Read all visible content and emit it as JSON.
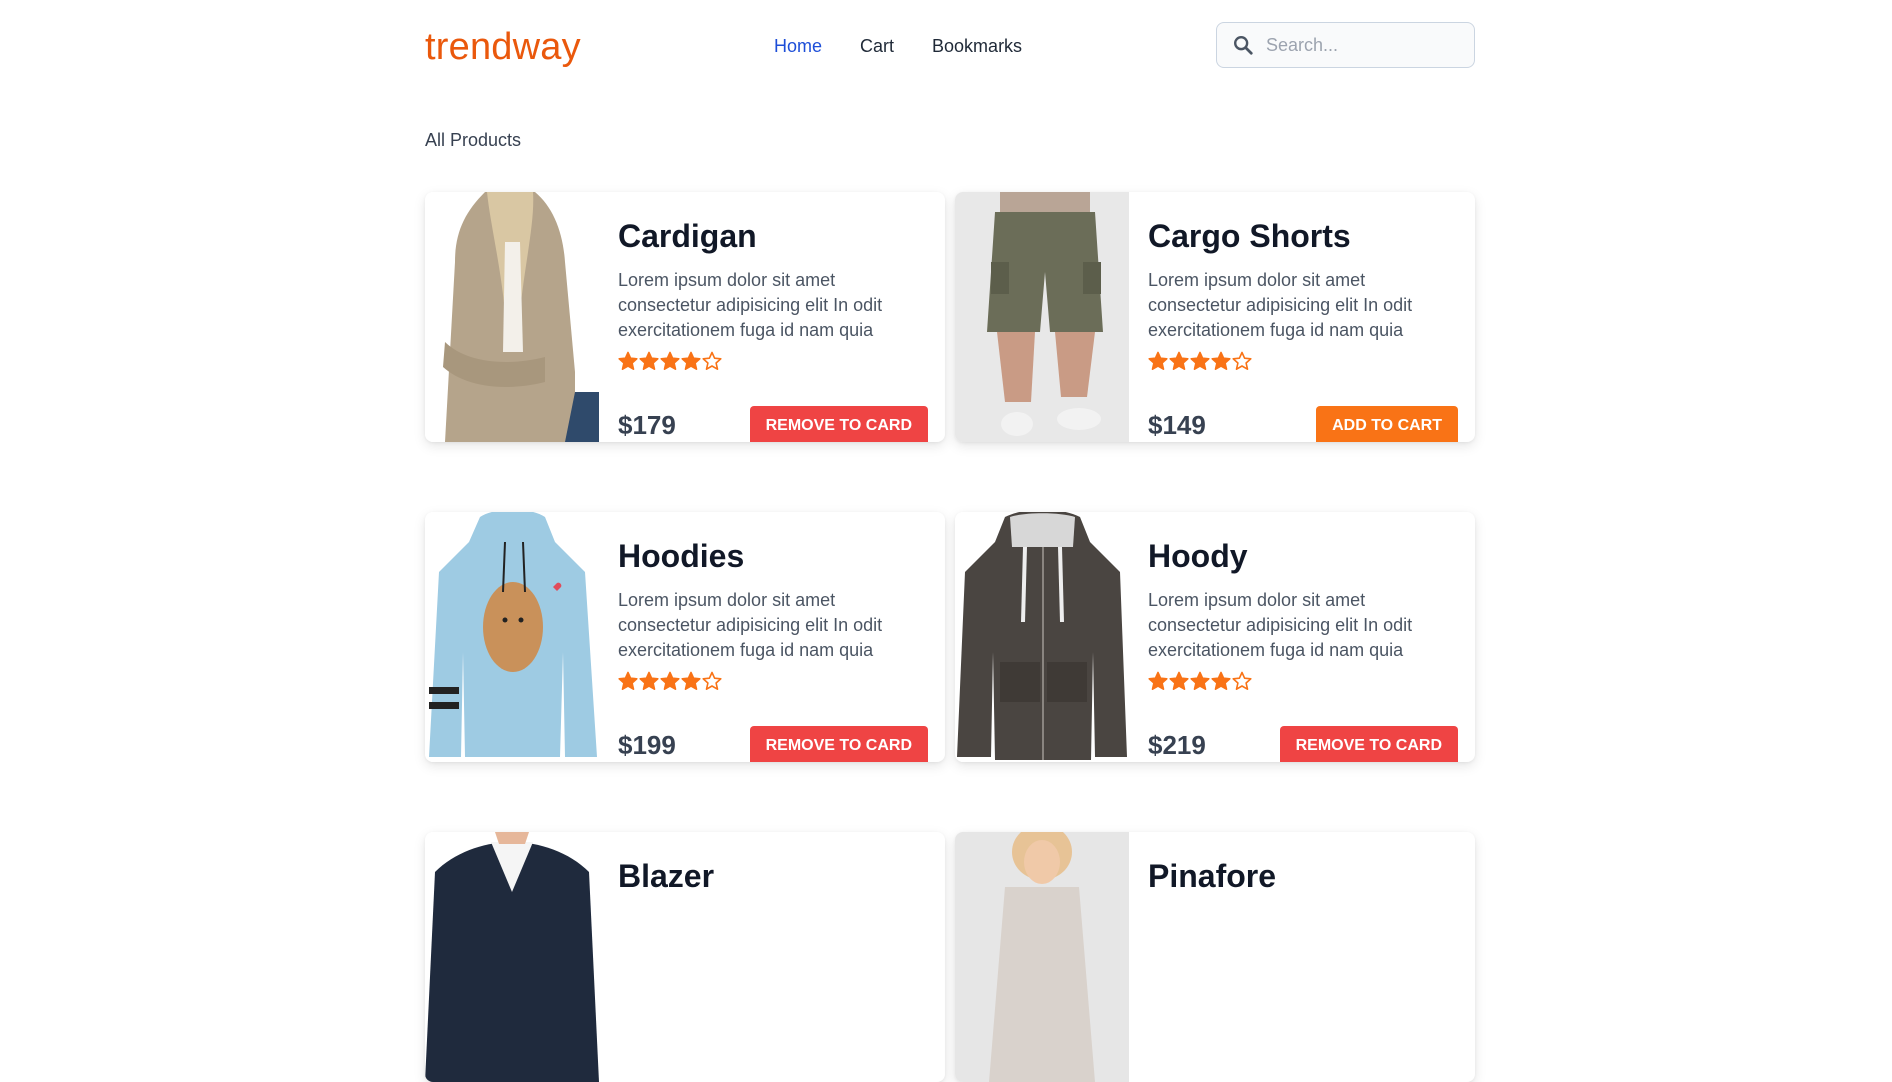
{
  "brand": "trendway",
  "nav": {
    "home": "Home",
    "cart": "Cart",
    "bookmarks": "Bookmarks"
  },
  "search": {
    "placeholder": "Search...",
    "value": ""
  },
  "section_title": "All Products",
  "products": [
    {
      "name": "Cardigan",
      "description": "Lorem ipsum dolor sit amet consectetur adipisicing elit In odit exercitationem fuga id nam quia",
      "rating": 4,
      "rating_max": 5,
      "price": "$179",
      "button": "REMOVE TO CARD",
      "button_type": "remove"
    },
    {
      "name": "Cargo Shorts",
      "description": "Lorem ipsum dolor sit amet consectetur adipisicing elit In odit exercitationem fuga id nam quia",
      "rating": 4,
      "rating_max": 5,
      "price": "$149",
      "button": "ADD TO CART",
      "button_type": "add"
    },
    {
      "name": "Hoodies",
      "description": "Lorem ipsum dolor sit amet consectetur adipisicing elit In odit exercitationem fuga id nam quia",
      "rating": 4,
      "rating_max": 5,
      "price": "$199",
      "button": "REMOVE TO CARD",
      "button_type": "remove"
    },
    {
      "name": "Hoody",
      "description": "Lorem ipsum dolor sit amet consectetur adipisicing elit In odit exercitationem fuga id nam quia",
      "rating": 4,
      "rating_max": 5,
      "price": "$219",
      "button": "REMOVE TO CARD",
      "button_type": "remove"
    },
    {
      "name": "Blazer"
    },
    {
      "name": "Pinafore"
    }
  ],
  "colors": {
    "brand": "#ea580c",
    "nav_active": "#1d4ed8",
    "star": "#f97316",
    "remove_button": "#ef4444",
    "add_button": "#f97316"
  },
  "icons": {
    "search": "search-icon",
    "star": "star-icon"
  }
}
